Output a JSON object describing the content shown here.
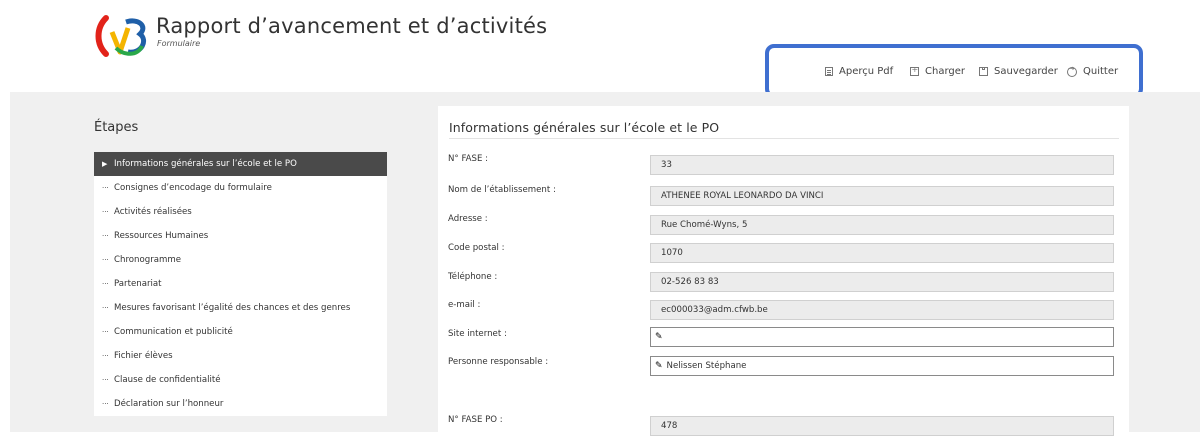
{
  "header": {
    "title": "Rapport d’avancement et d’activités",
    "subtitle": "Formulaire",
    "logo_icon": "brand-logo",
    "toolbar": [
      {
        "label": "Aperçu Pdf",
        "icon": "pdf-preview-icon"
      },
      {
        "label": "Charger",
        "icon": "upload-icon"
      },
      {
        "label": "Sauvegarder",
        "icon": "save-icon"
      },
      {
        "label": "Quitter",
        "icon": "exit-icon"
      }
    ],
    "highlight_color": "#3f6fd0"
  },
  "sidebar": {
    "title": "Étapes",
    "items": [
      {
        "label": "Informations générales sur l’école et le PO",
        "active": true,
        "marker": "▶"
      },
      {
        "label": "Consignes d’encodage du formulaire",
        "marker": "···"
      },
      {
        "label": "Activités réalisées",
        "marker": "···"
      },
      {
        "label": "Ressources Humaines",
        "marker": "···"
      },
      {
        "label": "Chronogramme",
        "marker": "···"
      },
      {
        "label": "Partenariat",
        "marker": "···"
      },
      {
        "label": "Mesures favorisant l’égalité des chances et des genres",
        "marker": "···"
      },
      {
        "label": "Communication et publicité",
        "marker": "···"
      },
      {
        "label": "Fichier élèves",
        "marker": "···"
      },
      {
        "label": "Clause de confidentialité",
        "marker": "···"
      },
      {
        "label": "Déclaration sur l’honneur",
        "marker": "···"
      }
    ]
  },
  "form": {
    "title": "Informations générales sur l’école et le PO",
    "fields": [
      {
        "label": "N° FASE :",
        "value": "33",
        "editable": false
      },
      {
        "label": "Nom de l’établissement :",
        "value": "ATHENEE ROYAL LEONARDO DA VINCI",
        "editable": false
      },
      {
        "label": "Adresse :",
        "value": "Rue Chomé-Wyns, 5",
        "editable": false
      },
      {
        "label": "Code postal :",
        "value": "1070",
        "editable": false
      },
      {
        "label": "Téléphone :",
        "value": "02-526 83 83",
        "editable": false
      },
      {
        "label": "e-mail :",
        "value": "ec000033@adm.cfwb.be",
        "editable": false
      },
      {
        "label": "Site internet :",
        "value": "",
        "editable": true
      },
      {
        "label": "Personne responsable :",
        "value": "Nelissen Stéphane",
        "editable": true
      },
      {
        "label": "N° FASE PO :",
        "value": "478",
        "editable": false
      }
    ]
  }
}
